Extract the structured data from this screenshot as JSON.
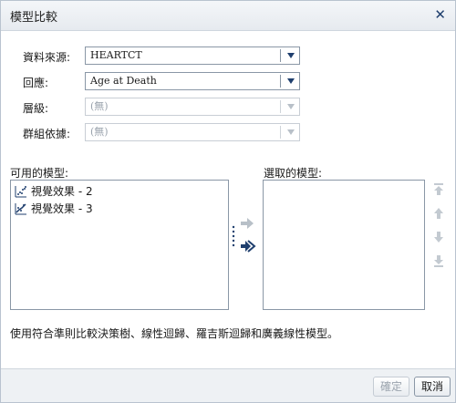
{
  "dialog": {
    "title": "模型比較"
  },
  "form": {
    "data_source": {
      "label": "資料來源:",
      "value": "HEARTCT"
    },
    "response": {
      "label": "回應:",
      "value": "Age at Death"
    },
    "level": {
      "label": "層級:",
      "value": "(無)"
    },
    "group_by": {
      "label": "群組依據:",
      "value": "(無)"
    }
  },
  "available": {
    "label": "可用的模型:",
    "items": [
      {
        "label": "視覺效果 - 2",
        "icon": "scatter-plot-icon"
      },
      {
        "label": "視覺效果 - 3",
        "icon": "regression-plot-icon"
      }
    ]
  },
  "selected": {
    "label": "選取的模型:"
  },
  "footer": {
    "description": "使用符合準則比較決策樹、線性迴歸、羅吉斯迴歸和廣義線性模型。"
  },
  "buttons": {
    "ok": "確定",
    "cancel": "取消"
  },
  "colors": {
    "accent": "#1f3f6e",
    "disabled": "#9aa3ad"
  }
}
